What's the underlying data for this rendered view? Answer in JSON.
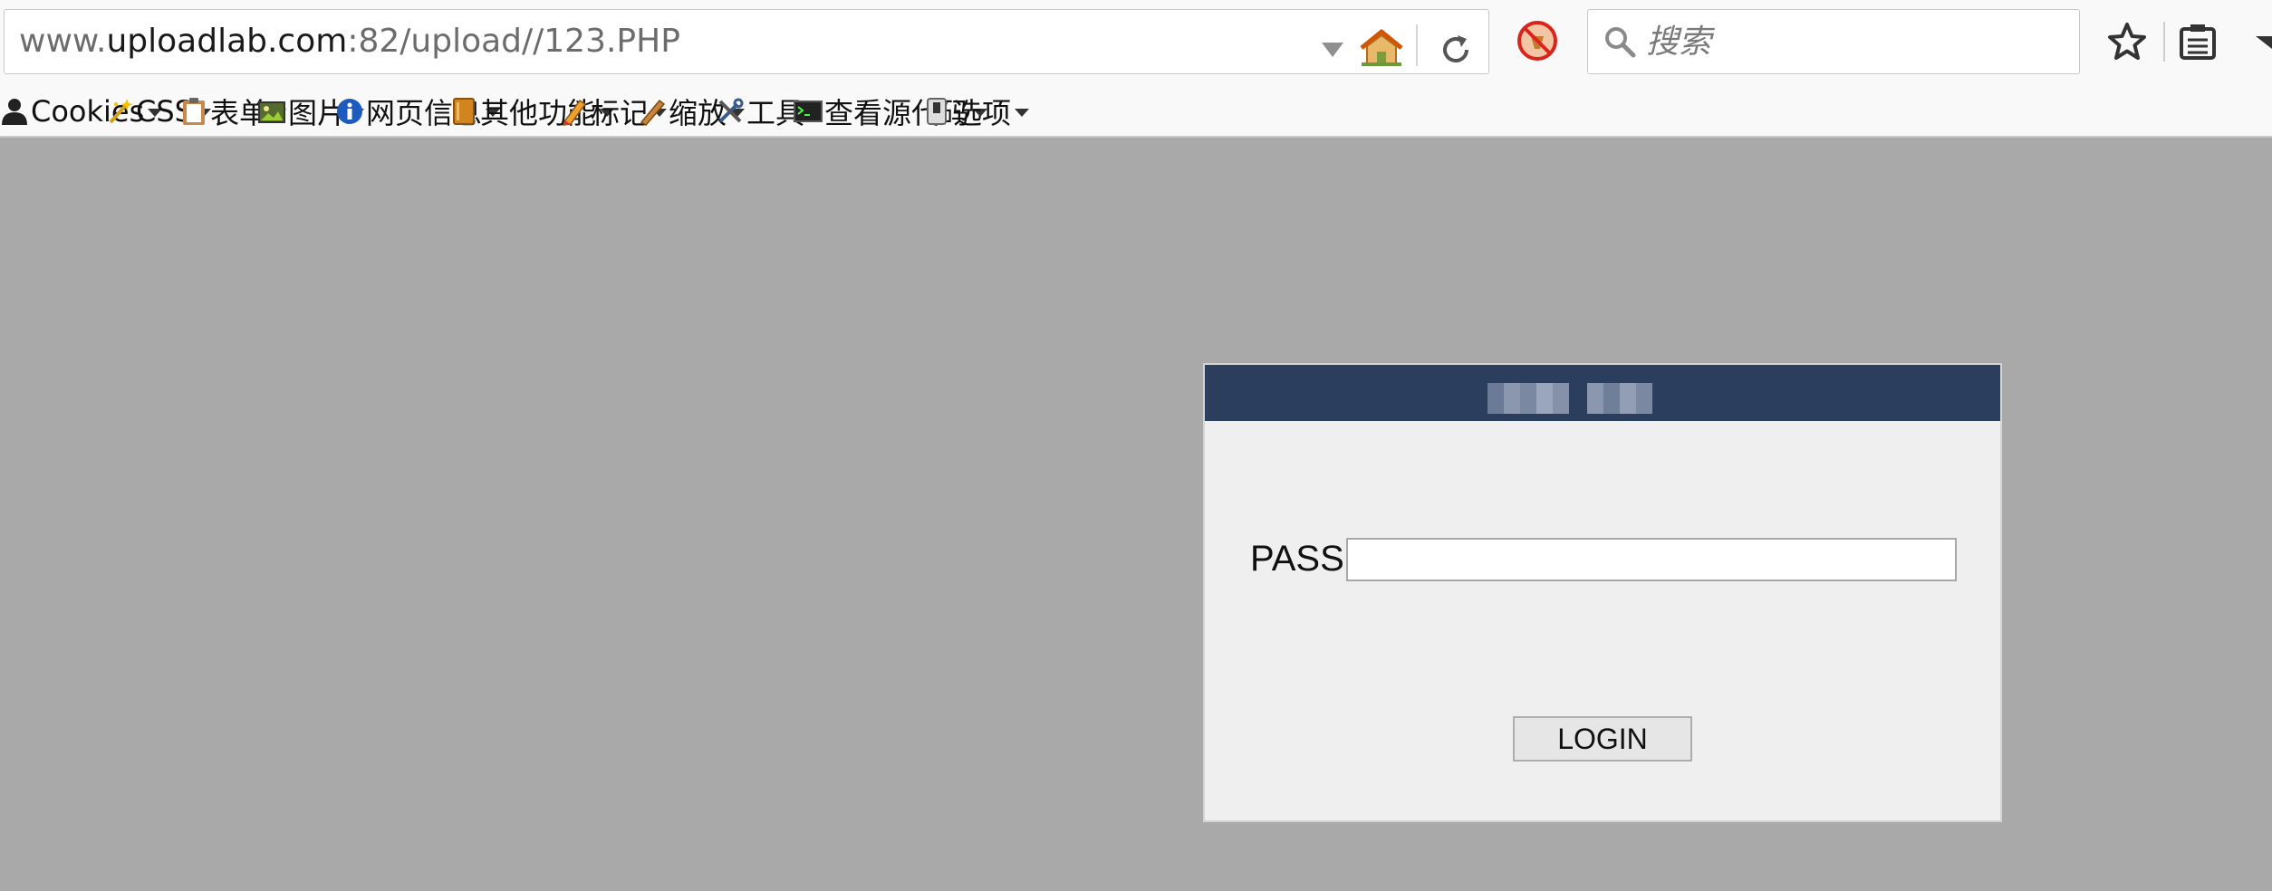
{
  "browser": {
    "url": {
      "prefix": "www.",
      "host": "uploadlab.com",
      "suffix": ":82/upload//123.PHP"
    },
    "search": {
      "placeholder": "搜索"
    }
  },
  "dev_toolbar": {
    "items": [
      {
        "label": "Cookies",
        "icon": "cookie-person-icon"
      },
      {
        "label": "CSS",
        "icon": "css-wand-icon"
      },
      {
        "label": "表单",
        "icon": "clipboard-icon"
      },
      {
        "label": "图片",
        "icon": "image-icon"
      },
      {
        "label": "网页信息",
        "icon": "info-icon"
      },
      {
        "label": "其他功能",
        "icon": "book-icon"
      },
      {
        "label": "标记",
        "icon": "pencil-icon"
      },
      {
        "label": "缩放",
        "icon": "ruler-icon"
      },
      {
        "label": "工具",
        "icon": "wrench-icon"
      },
      {
        "label": "查看源代码",
        "icon": "terminal-icon"
      },
      {
        "label": "选项",
        "icon": "switch-icon"
      }
    ]
  },
  "login": {
    "pass_label": "PASS:",
    "pass_value": "",
    "login_button": "LOGIN"
  },
  "colors": {
    "page_background": "#a9a9a9",
    "panel_header": "#2c3e5e",
    "panel_body": "#efefef"
  }
}
